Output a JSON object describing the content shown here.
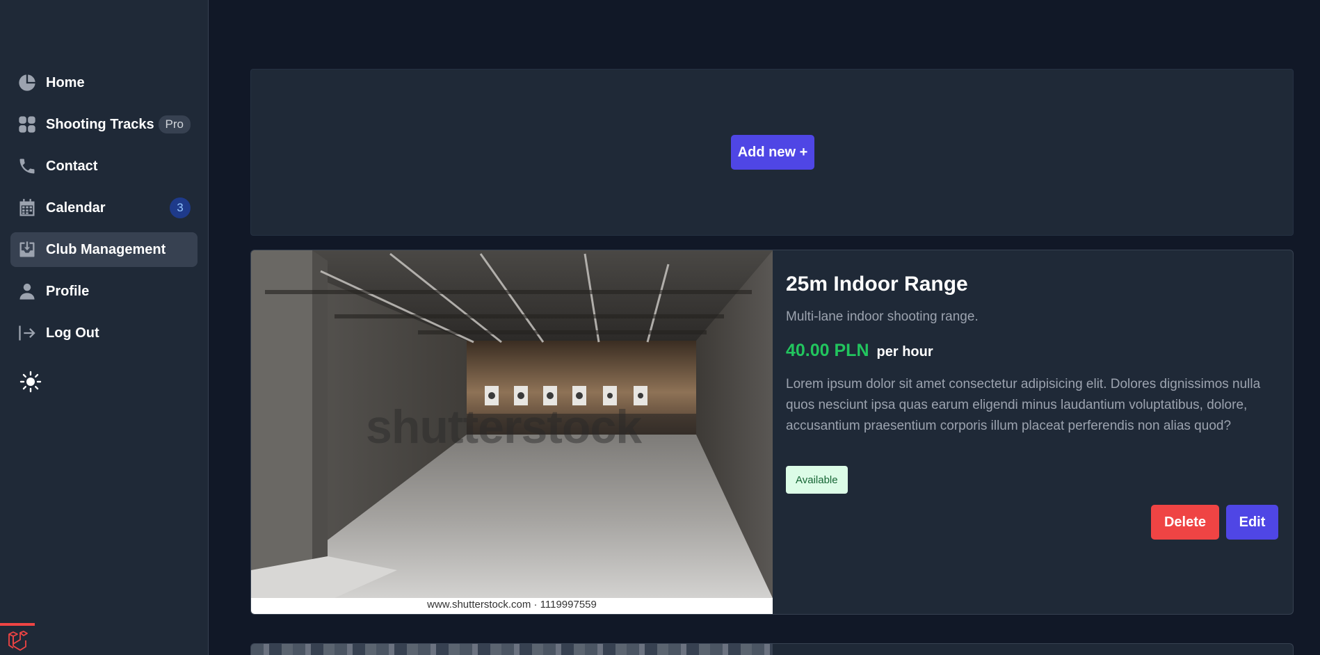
{
  "sidebar": {
    "items": [
      {
        "label": "Home",
        "icon": "pie-chart-icon"
      },
      {
        "label": "Shooting Tracks",
        "icon": "grid-icon",
        "badge": "Pro"
      },
      {
        "label": "Contact",
        "icon": "phone-icon"
      },
      {
        "label": "Calendar",
        "icon": "calendar-icon",
        "badge": "3"
      },
      {
        "label": "Club Management",
        "icon": "inbox-download-icon",
        "active": true
      },
      {
        "label": "Profile",
        "icon": "user-icon"
      },
      {
        "label": "Log Out",
        "icon": "logout-icon"
      }
    ],
    "theme_icon": "sun-icon",
    "logo_icon": "laravel-icon"
  },
  "main": {
    "add_button": "Add new +"
  },
  "cards": [
    {
      "title": "25m Indoor Range",
      "subtitle": "Multi-lane indoor shooting range.",
      "price": "40.00 PLN",
      "unit": "per hour",
      "description": "Lorem ipsum dolor sit amet consectetur adipisicing elit. Dolores dignissimos nulla quos nesciunt ipsa quas earum eligendi minus laudantium voluptatibus, dolore, accusantium praesentium corporis illum placeat perferendis non alias quod?",
      "status": "Available",
      "delete_label": "Delete",
      "edit_label": "Edit",
      "image": {
        "watermark": "shutterstock",
        "caption": "www.shutterstock.com · 1119997559"
      }
    }
  ],
  "colors": {
    "accent": "#4f46e5",
    "danger": "#ef4444",
    "price": "#22c55e",
    "sidebar_bg": "#1f2937",
    "page_bg": "#111827"
  }
}
